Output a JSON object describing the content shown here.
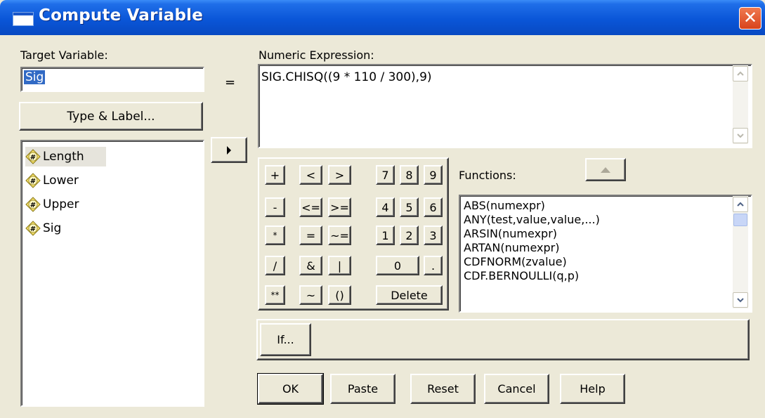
{
  "window": {
    "title": "Compute Variable",
    "close": "✕"
  },
  "target": {
    "label": "Target Variable:",
    "value": "Sig"
  },
  "equals": "=",
  "expression": {
    "label": "Numeric Expression:",
    "value": "SIG.CHISQ((9 * 110 / 300),9)"
  },
  "type_label_button": "Type & Label...",
  "variables": [
    "Length",
    "Lower",
    "Upper",
    "Sig"
  ],
  "keypad": [
    [
      "+",
      "<",
      ">",
      "7",
      "8",
      "9"
    ],
    [
      "-",
      "<=",
      ">=",
      "4",
      "5",
      "6"
    ],
    [
      "*",
      "=",
      "~=",
      "1",
      "2",
      "3"
    ],
    [
      "/",
      "&",
      "|",
      "0",
      "."
    ],
    [
      "**",
      "~",
      "()",
      "Delete"
    ]
  ],
  "functions": {
    "label": "Functions:",
    "items": [
      "ABS(numexpr)",
      "ANY(test,value,value,...)",
      "ARSIN(numexpr)",
      "ARTAN(numexpr)",
      "CDFNORM(zvalue)",
      "CDF.BERNOULLI(q,p)"
    ]
  },
  "if_button": "If...",
  "buttons": {
    "ok": "OK",
    "paste": "Paste",
    "reset": "Reset",
    "cancel": "Cancel",
    "help": "Help"
  },
  "colors": {
    "title_bar": "#0a56d8",
    "selection": "#316ac5",
    "dialog_bg": "#ece9d8"
  }
}
